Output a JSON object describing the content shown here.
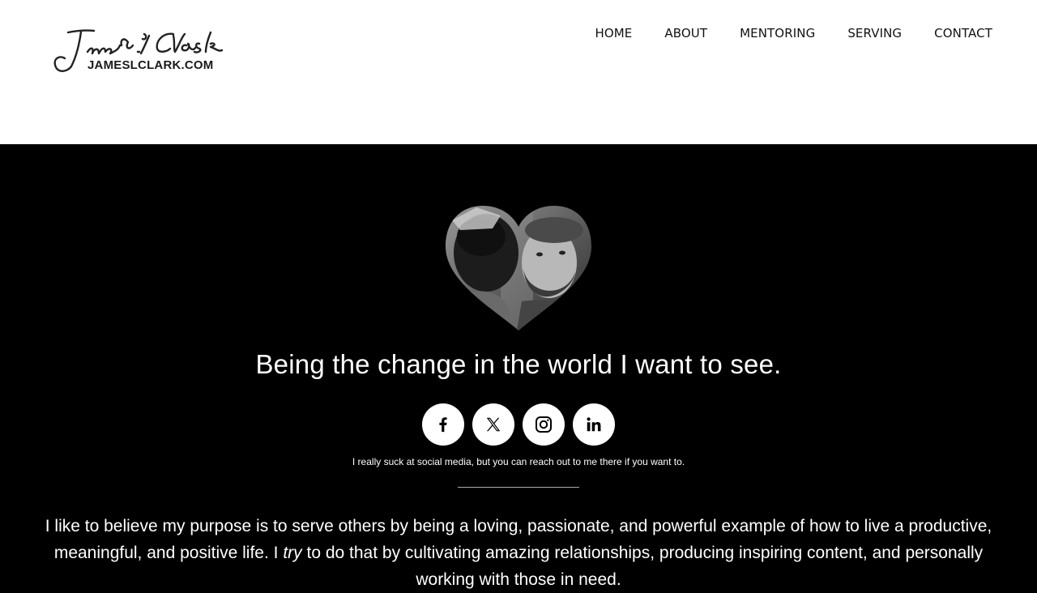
{
  "brand": {
    "logo_text": "James L Clark",
    "url_text": "JAMESLCLARK.COM"
  },
  "nav": {
    "items": [
      {
        "label": "HOME"
      },
      {
        "label": "ABOUT"
      },
      {
        "label": "MENTORING"
      },
      {
        "label": "SERVING"
      },
      {
        "label": "CONTACT"
      }
    ]
  },
  "hero": {
    "tagline": "Being the change in the world I want to see.",
    "social_note": "I really suck at social media, but you can reach out to me there if you want to.",
    "purpose_before": "I like to believe my purpose is to serve others by being a loving, passionate, and powerful example of how to live a productive, meaningful, and positive life. I ",
    "purpose_emphasis": "try",
    "purpose_after": " to do that by cultivating amazing relationships, producing inspiring content, and personally working with those in need."
  },
  "socials": [
    {
      "icon": "facebook-icon"
    },
    {
      "icon": "x-icon"
    },
    {
      "icon": "instagram-icon"
    },
    {
      "icon": "linkedin-icon"
    }
  ],
  "colors": {
    "header_bg": "#ffffff",
    "hero_bg": "#000000",
    "text_light": "#ffffff",
    "text_dark": "#111111"
  }
}
